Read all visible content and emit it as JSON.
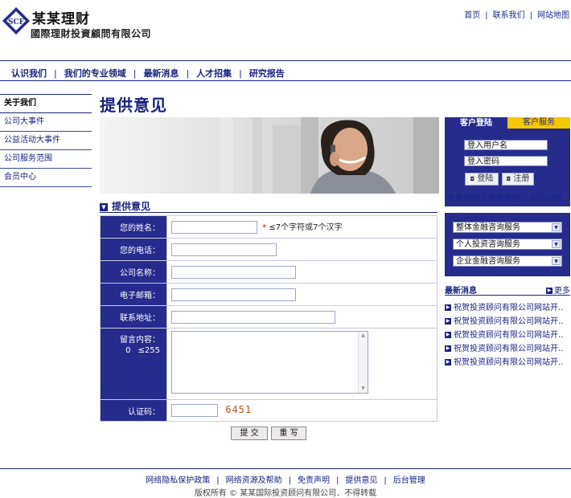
{
  "header": {
    "logo_mark": "SCF",
    "company_name": "某某理财",
    "company_full": "國際理財投資顧問有限公司",
    "top_links": [
      "首页",
      "联系我们",
      "网站地图"
    ]
  },
  "nav": {
    "items": [
      "认识我们",
      "我们的专业领域",
      "最新消息",
      "人才招集",
      "研究报告"
    ]
  },
  "sidebar": {
    "items": [
      "关于我们",
      "公司大事件",
      "公益活动大事件",
      "公司服务范围",
      "会员中心"
    ]
  },
  "main": {
    "page_title": "提供意见",
    "section_title": "提供意见",
    "form": {
      "name_label": "您的姓名：",
      "name_hint_star": "*",
      "name_hint": "≤7个字符或7个汉字",
      "phone_label": "您的电话：",
      "company_label": "公司名称：",
      "email_label": "电子邮箱：",
      "address_label": "联系地址：",
      "message_label": "留言内容：",
      "message_count": "0",
      "message_max": "≤255",
      "captcha_label": "认证码：",
      "captcha_value": "6451",
      "submit_label": "提 交",
      "reset_label": "重 写"
    }
  },
  "login": {
    "tab_login": "客户登陆",
    "tab_service": "客户服务",
    "username_value": "登入用户名",
    "password_value": "登入密码",
    "login_button": "登陆",
    "register_button": "注册",
    "links": [
      "免责声明",
      "服务简介",
      "常见问题"
    ]
  },
  "services": {
    "options": [
      "整体金融咨询服务",
      "个人投资咨询服务",
      "企业金融咨询服务"
    ]
  },
  "news": {
    "title": "最新消息",
    "more": "更多",
    "items": [
      "祝贺投资顾问有限公司网站开..",
      "祝贺投资顾问有限公司网站开..",
      "祝贺投资顾问有限公司网站开..",
      "祝贺投资顾问有限公司网站开..",
      "祝贺投资顾问有限公司网站开.."
    ]
  },
  "footer": {
    "links": [
      "网络隐私保护政策",
      "网络资源及帮助",
      "免责声明",
      "提供意见",
      "后台管理"
    ],
    "copyright": "版权所有 © 某某国际投资顾问有限公司．不得转载"
  },
  "colors": {
    "primary": "#262b8c",
    "accent": "#f5c800",
    "captcha": "#c05020"
  }
}
